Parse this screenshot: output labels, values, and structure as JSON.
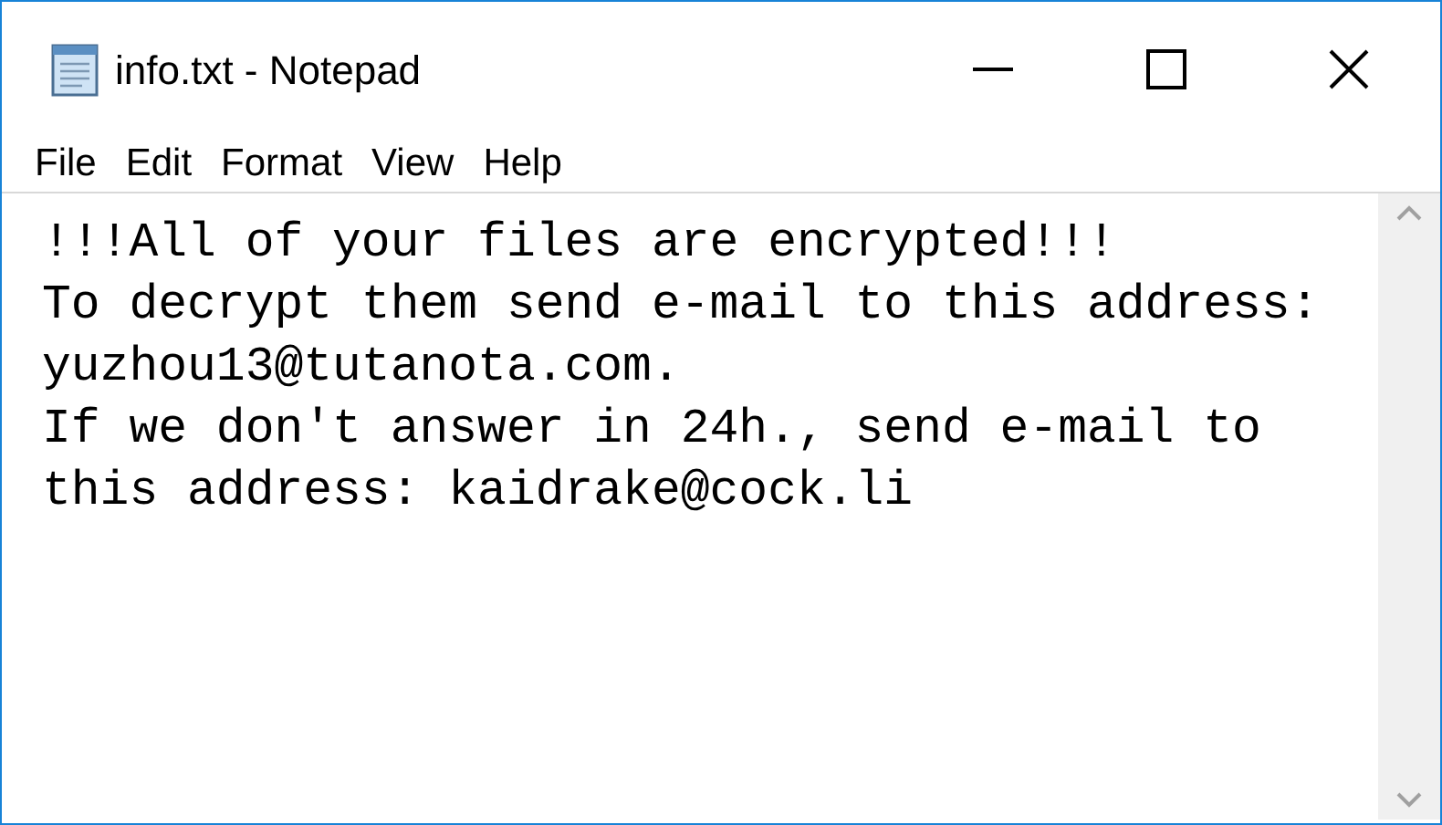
{
  "window": {
    "title": "info.txt - Notepad"
  },
  "menu": [
    {
      "label": "File"
    },
    {
      "label": "Edit"
    },
    {
      "label": "Format"
    },
    {
      "label": "View"
    },
    {
      "label": "Help"
    }
  ],
  "document": {
    "lines": [
      "!!!All of your files are encrypted!!!",
      "To decrypt them send e-mail to this address:",
      "yuzhou13@tutanota.com.",
      "If we don't answer in 24h., send e-mail to",
      "this address: kaidrake@cock.li"
    ]
  }
}
